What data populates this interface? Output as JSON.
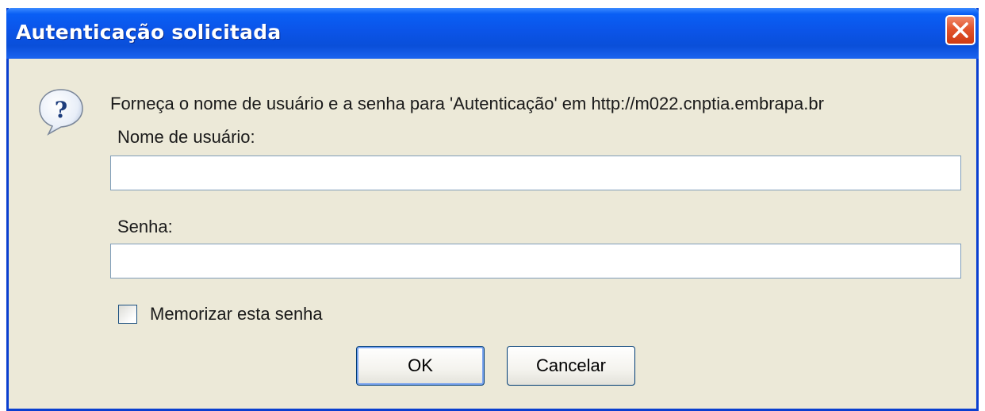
{
  "dialog": {
    "title": "Autenticação solicitada",
    "prompt": "Forneça o nome de usuário e a senha para 'Autenticação' em http://m022.cnptia.embrapa.br",
    "icon": "question-icon",
    "colors": {
      "titlebar": "#0a4fd9",
      "body": "#ece9d8",
      "close": "#e2542c"
    }
  },
  "form": {
    "username_label": "Nome de usuário:",
    "username_value": "",
    "password_label": "Senha:",
    "password_value": "",
    "remember_label": "Memorizar esta senha",
    "remember_checked": false
  },
  "buttons": {
    "ok_label": "OK",
    "cancel_label": "Cancelar"
  }
}
